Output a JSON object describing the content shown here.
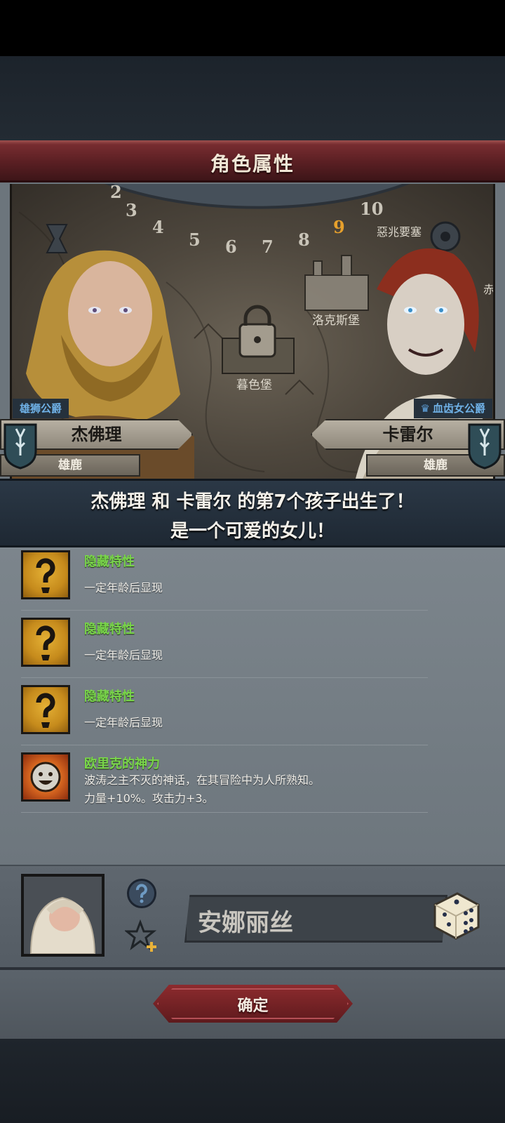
{
  "header": {
    "title": "角色属性"
  },
  "map": {
    "dial_numbers": [
      "2",
      "3",
      "4",
      "5",
      "6",
      "7",
      "8",
      "9",
      "10"
    ],
    "active_number": "9",
    "locations": [
      "暮色堡",
      "洛克斯堡",
      "惡兆要塞",
      "赤"
    ]
  },
  "father": {
    "name": "杰佛理",
    "title": "雄狮公爵",
    "house": "雄鹿"
  },
  "mother": {
    "name": "卡雷尔",
    "title": "血齿女公爵",
    "house": "雄鹿"
  },
  "announcement": {
    "line1": "杰佛理 和 卡雷尔 的第7个孩子出生了！",
    "line2": "是一个可爱的女儿！"
  },
  "traits": [
    {
      "name": "隐藏特性",
      "desc1": "",
      "desc2": "一定年龄后显现",
      "icon": "question-icon"
    },
    {
      "name": "隐藏特性",
      "desc1": "",
      "desc2": "一定年龄后显现",
      "icon": "question-icon"
    },
    {
      "name": "隐藏特性",
      "desc1": "",
      "desc2": "一定年龄后显现",
      "icon": "question-icon"
    },
    {
      "name": "欧里克的神力",
      "desc1": "波涛之主不灭的神话，在其冒险中为人所熟知。",
      "desc2": "力量+10%。攻击力+3。",
      "icon": "smiling-face-icon"
    }
  ],
  "child": {
    "name": "安娜丽丝"
  },
  "actions": {
    "confirm_label": "确定"
  },
  "colors": {
    "title_bar": "#6b2428",
    "trait_name": "#79d64a",
    "tag_text": "#6fb1e6",
    "confirm": "#7a2428"
  }
}
